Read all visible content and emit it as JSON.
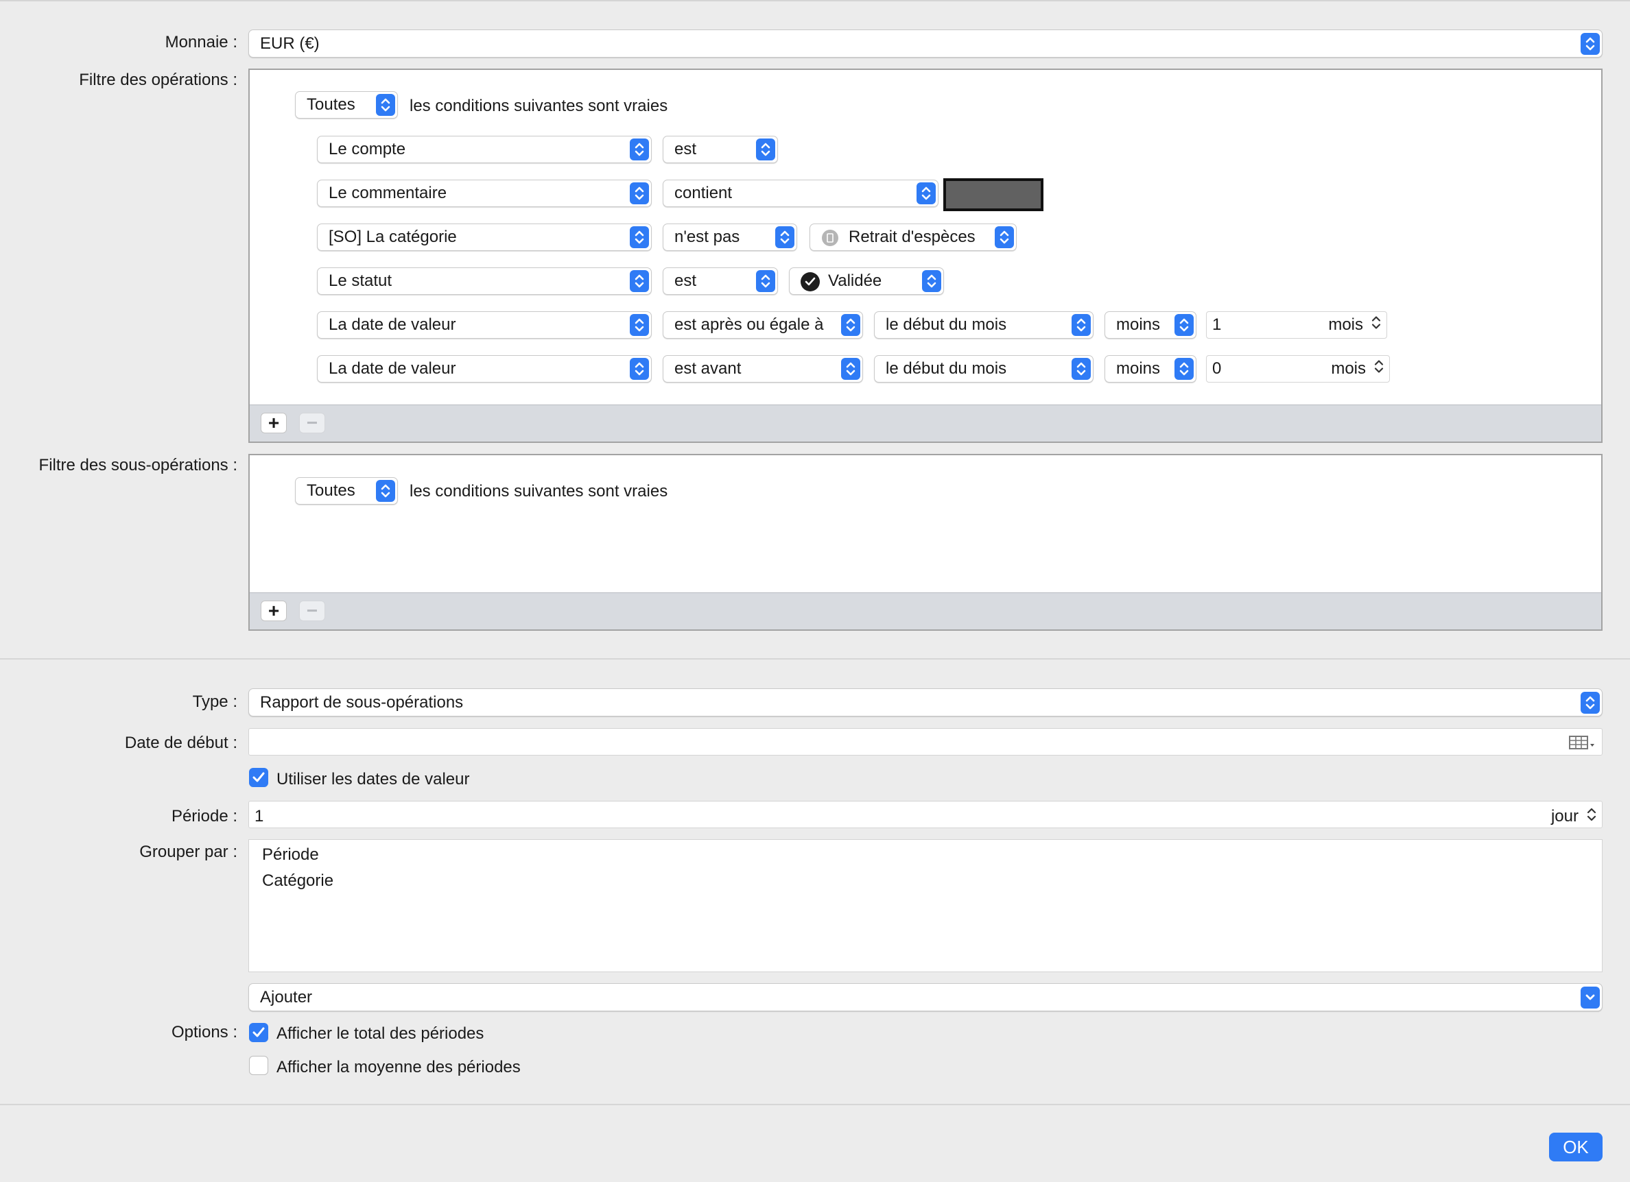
{
  "currency": {
    "label": "Monnaie :",
    "value": "EUR (€)"
  },
  "ops_filter": {
    "label": "Filtre des opérations :",
    "match_mode": "Toutes",
    "match_text": "les conditions suivantes sont vraies",
    "rules": [
      {
        "field": "Le compte",
        "op": "est"
      },
      {
        "field": "Le commentaire",
        "op": "contient"
      },
      {
        "field": "[SO] La catégorie",
        "op": "n'est pas",
        "value": "Retrait d'espèces"
      },
      {
        "field": "Le statut",
        "op": "est",
        "value": "Validée"
      },
      {
        "field": "La date de valeur",
        "op": "est après ou égale à",
        "ref": "le début du mois",
        "sign": "moins",
        "amount": "1",
        "unit": "mois"
      },
      {
        "field": "La date de valeur",
        "op": "est avant",
        "ref": "le début du mois",
        "sign": "moins",
        "amount": "0",
        "unit": "mois"
      }
    ],
    "add_label": "+",
    "remove_label": "−"
  },
  "subops_filter": {
    "label": "Filtre des sous-opérations :",
    "match_mode": "Toutes",
    "match_text": "les conditions suivantes sont vraies",
    "add_label": "+",
    "remove_label": "−"
  },
  "type": {
    "label": "Type :",
    "value": "Rapport de sous-opérations"
  },
  "start_date": {
    "label": "Date de début :",
    "value": ""
  },
  "use_value_dates": {
    "label": "Utiliser les dates de valeur",
    "checked": true
  },
  "period": {
    "label": "Période :",
    "value": "1",
    "unit": "jour"
  },
  "group_by": {
    "label": "Grouper par :",
    "items": [
      "Période",
      "Catégorie"
    ]
  },
  "add_group": {
    "value": "Ajouter"
  },
  "options": {
    "label": "Options :",
    "show_total": {
      "label": "Afficher le total des périodes",
      "checked": true
    },
    "show_average": {
      "label": "Afficher la moyenne des périodes",
      "checked": false
    }
  },
  "ok_label": "OK",
  "colors": {
    "accent": "#2f7bf5",
    "footer": "#d8dbe0"
  }
}
